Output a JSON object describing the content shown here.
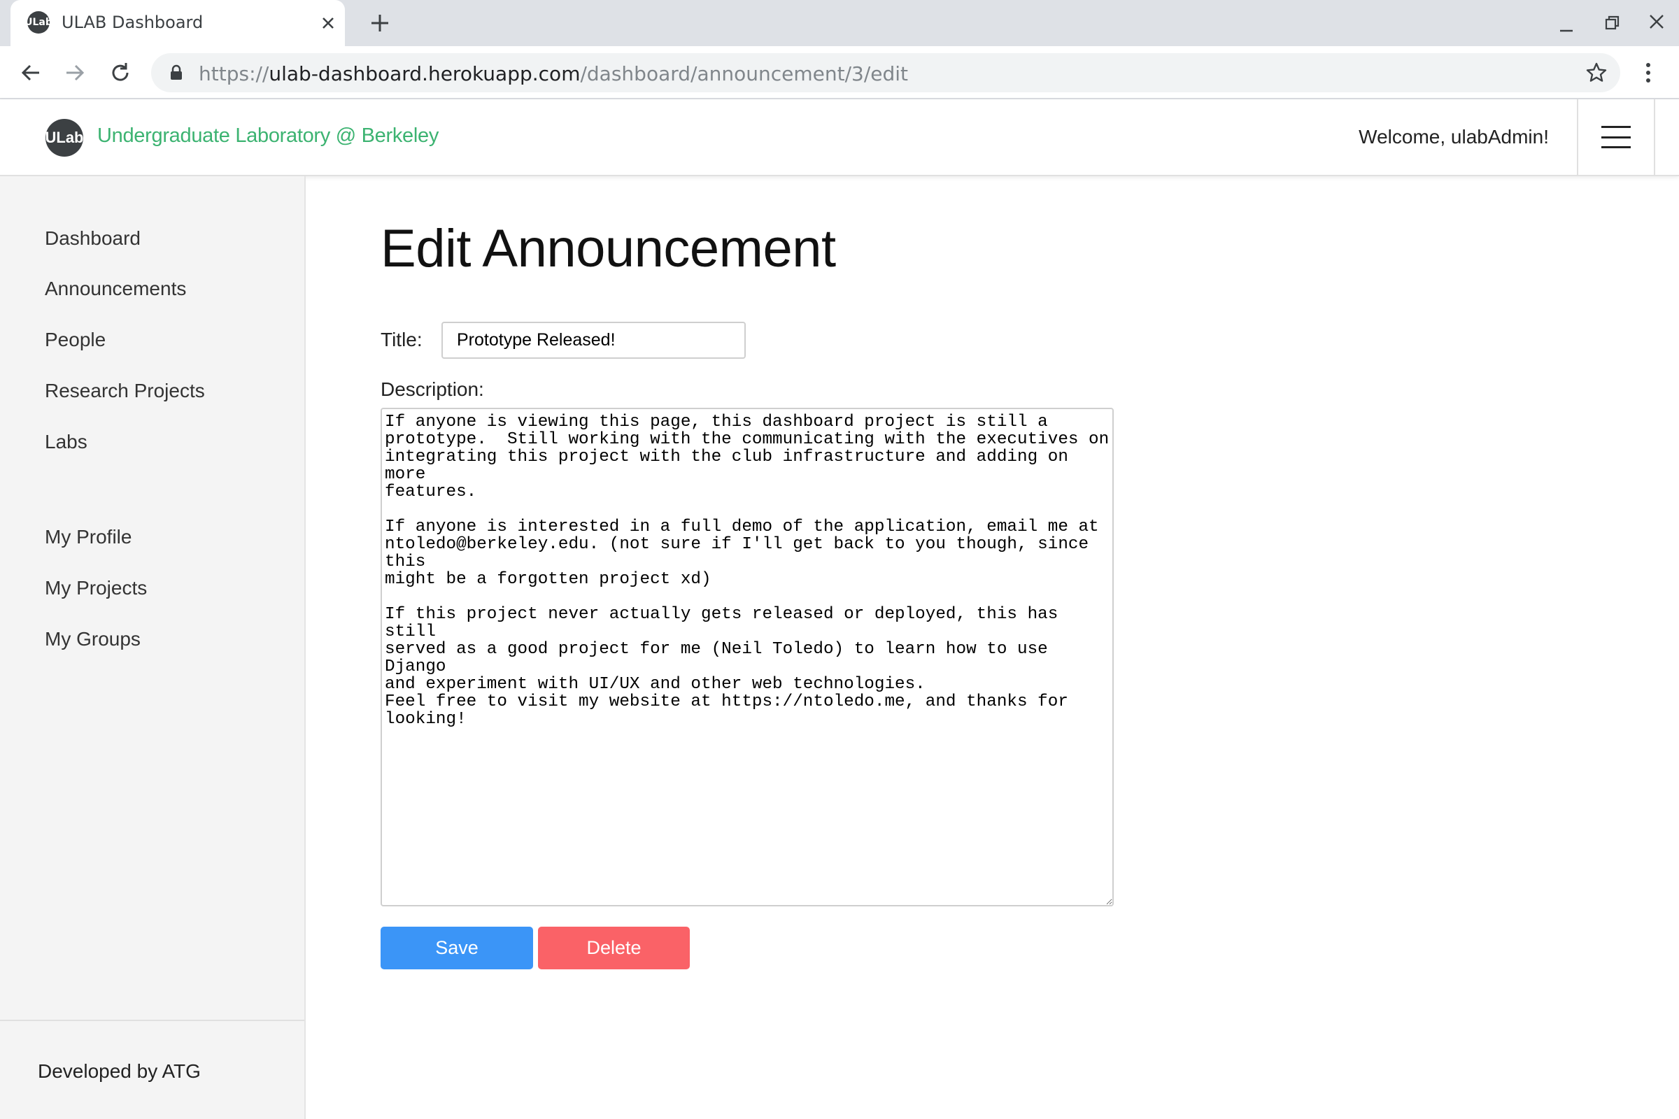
{
  "browser": {
    "tab_title": "ULAB Dashboard",
    "favicon_text": "ULab",
    "url_scheme": "https://",
    "url_host": "ulab-dashboard.herokuapp.com",
    "url_path": "/dashboard/announcement/3/edit",
    "icons": [
      "close-icon",
      "plus-icon",
      "minimize-icon",
      "restore-icon",
      "back-icon",
      "forward-icon",
      "reload-icon",
      "lock-icon",
      "star-icon",
      "more-vert-icon"
    ]
  },
  "header": {
    "logo_text": "ULab",
    "brand": "Undergraduate Laboratory @ Berkeley",
    "welcome": "Welcome, ulabAdmin!",
    "brand_color": "#3cb371"
  },
  "sidebar": {
    "items": [
      {
        "label": "Dashboard"
      },
      {
        "label": "Announcements"
      },
      {
        "label": "People"
      },
      {
        "label": "Research Projects"
      },
      {
        "label": "Labs"
      },
      {
        "label": "My Profile"
      },
      {
        "label": "My Projects"
      },
      {
        "label": "My Groups"
      }
    ],
    "footer": "Developed by ATG"
  },
  "main": {
    "page_title": "Edit Announcement",
    "title_label": "Title:",
    "title_value": "Prototype Released!",
    "description_label": "Description:",
    "description_value": "If anyone is viewing this page, this dashboard project is still a\nprototype.  Still working with the communicating with the executives on\nintegrating this project with the club infrastructure and adding on more\nfeatures.\n\nIf anyone is interested in a full demo of the application, email me at\nntoledo@berkeley.edu. (not sure if I'll get back to you though, since this\nmight be a forgotten project xd)\n\nIf this project never actually gets released or deployed, this has still\nserved as a good project for me (Neil Toledo) to learn how to use Django\nand experiment with UI/UX and other web technologies.\nFeel free to visit my website at https://ntoledo.me, and thanks for\nlooking!",
    "save_label": "Save",
    "delete_label": "Delete",
    "save_color": "#3b95f7",
    "delete_color": "#fa6267"
  }
}
